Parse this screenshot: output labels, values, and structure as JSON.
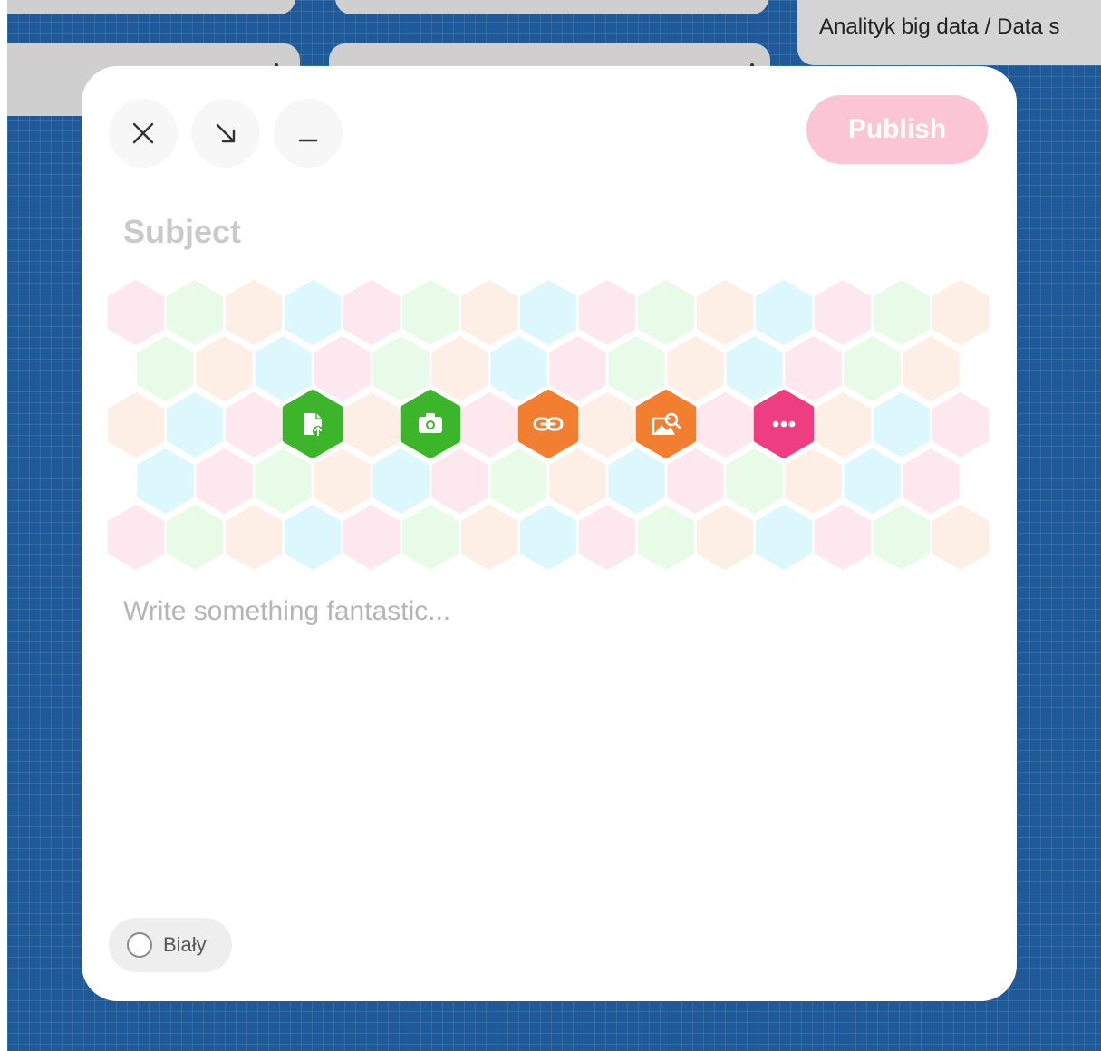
{
  "background_cards": {
    "visible_title": "Analityk big data / Data s"
  },
  "composer": {
    "close_label": "×",
    "restore_label": "↘",
    "minimize_label": "_",
    "publish_label": "Publish",
    "subject_placeholder": "Subject",
    "body_placeholder": "Write something fantastic...",
    "color_option_label": "Biały",
    "attachments": [
      {
        "name": "upload-file-icon",
        "color": "#3cb52a"
      },
      {
        "name": "camera-icon",
        "color": "#3cb52a"
      },
      {
        "name": "link-icon",
        "color": "#f27e31"
      },
      {
        "name": "image-search-icon",
        "color": "#f27e31"
      },
      {
        "name": "more-icon",
        "color": "#ee3d81"
      }
    ]
  },
  "colors": {
    "board": "#1e5a9a",
    "publish_disabled": "#fbc5d6",
    "hex_pink": "#fde8ef",
    "hex_green": "#e8fbe8",
    "hex_peach": "#fdeee6",
    "hex_cyan": "#ddf8fd"
  }
}
